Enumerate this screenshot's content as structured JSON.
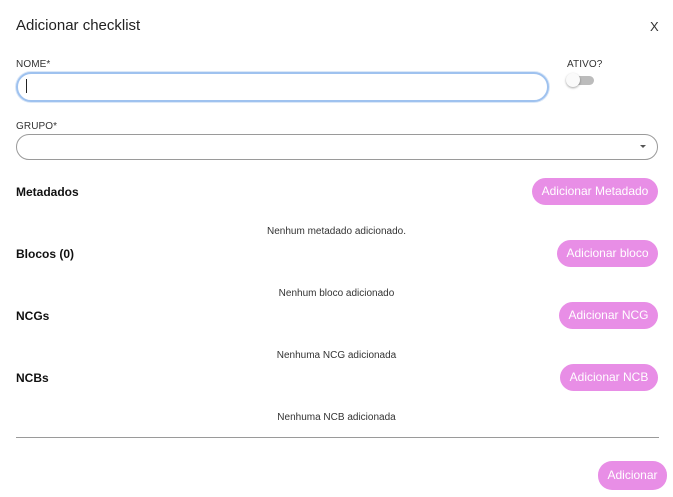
{
  "dialog": {
    "title": "Adicionar checklist",
    "close_label": "X"
  },
  "form": {
    "name_label": "NOME*",
    "name_value": "",
    "active_label": "ATIVO?",
    "active_on": false,
    "group_label": "GRUPO*",
    "group_value": ""
  },
  "sections": {
    "metadados": {
      "title": "Metadados",
      "button": "Adicionar Metadado",
      "empty": "Nenhum metadado adicionado."
    },
    "blocos": {
      "title": "Blocos (0)",
      "button": "Adicionar bloco",
      "empty": "Nenhum bloco adicionado"
    },
    "ncgs": {
      "title": "NCGs",
      "button": "Adicionar NCG",
      "empty": "Nenhuma NCG adicionada"
    },
    "ncbs": {
      "title": "NCBs",
      "button": "Adicionar NCB",
      "empty": "Nenhuma NCB adicionada"
    }
  },
  "footer": {
    "submit": "Adicionar"
  },
  "colors": {
    "accent": "#e88ee6",
    "focus_border": "#9fc2ef"
  }
}
